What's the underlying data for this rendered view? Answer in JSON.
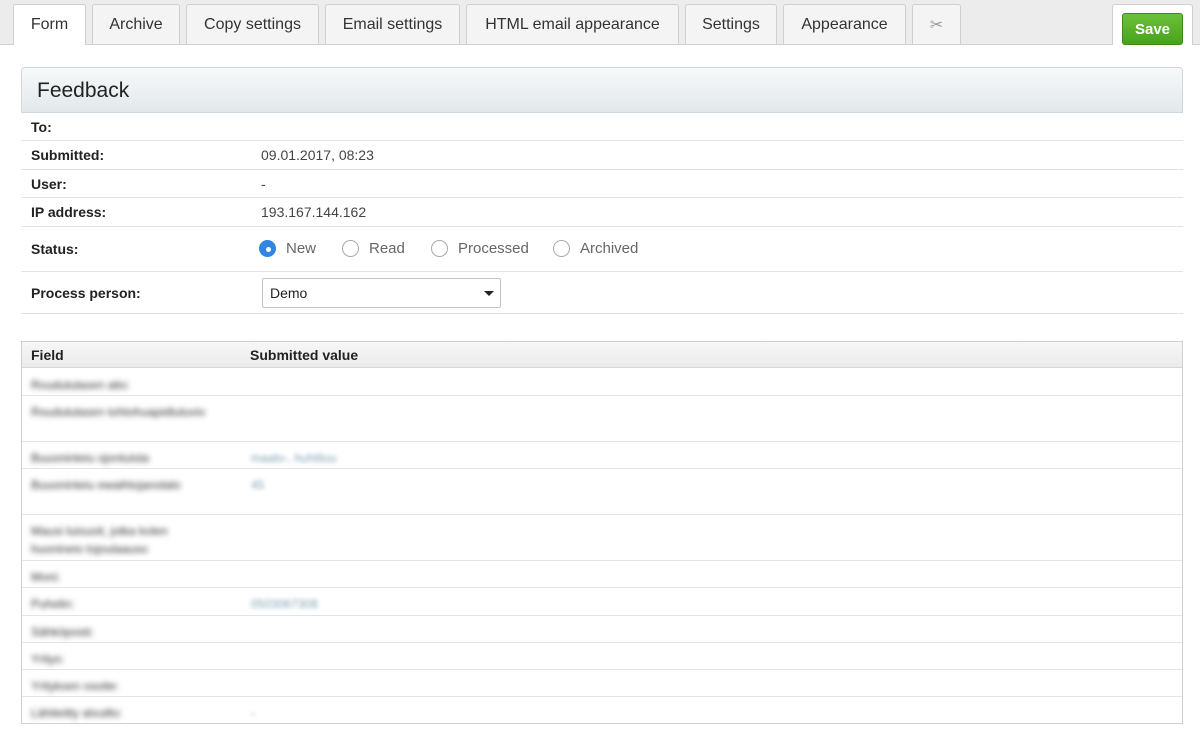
{
  "tabs": [
    {
      "label": "Form"
    },
    {
      "label": "Archive"
    },
    {
      "label": "Copy settings"
    },
    {
      "label": "Email settings"
    },
    {
      "label": "HTML email appearance"
    },
    {
      "label": "Settings"
    },
    {
      "label": "Appearance"
    }
  ],
  "toolbar": {
    "save_label": "Save",
    "more_icon": "scissors-icon"
  },
  "panel": {
    "title": "Feedback"
  },
  "info": {
    "to_label": "To:",
    "to_value": "",
    "submitted_label": "Submitted:",
    "submitted_value": "09.01.2017, 08:23",
    "user_label": "User:",
    "user_value": "-",
    "ip_label": "IP address:",
    "ip_value": "193.167.144.162",
    "status_label": "Status:",
    "status_options": [
      "New",
      "Read",
      "Processed",
      "Archived"
    ],
    "status_selected": "New",
    "process_label": "Process person:",
    "process_value": "Demo"
  },
  "table": {
    "columns": [
      "Field",
      "Submitted value"
    ],
    "rows": [
      {
        "field": "Roudululasen alio:",
        "value": ""
      },
      {
        "field": "Roudululasen tohtohuapidtuluvio",
        "value": ""
      },
      {
        "field": "Buuoninteiu ojontuista",
        "value": "maalo-, huhtiluu"
      },
      {
        "field": "Buuoninteiu ewaihtojanolalo",
        "value": "45"
      },
      {
        "field": "Mausi luisuoit, jotka kolen huonineio tojoulaauso",
        "value": ""
      },
      {
        "field": "Moni:",
        "value": ""
      },
      {
        "field": "Puhelin:",
        "value": "0503067308"
      },
      {
        "field": "Sähköposti:",
        "value": ""
      },
      {
        "field": "Yritys:",
        "value": ""
      },
      {
        "field": "Yrityksen osoite:",
        "value": ""
      },
      {
        "field": "Lähiteitty alvuillo:",
        "value": "-"
      }
    ]
  },
  "colors": {
    "accent_blue": "#2f86e3",
    "save_green": "#4caf20"
  }
}
